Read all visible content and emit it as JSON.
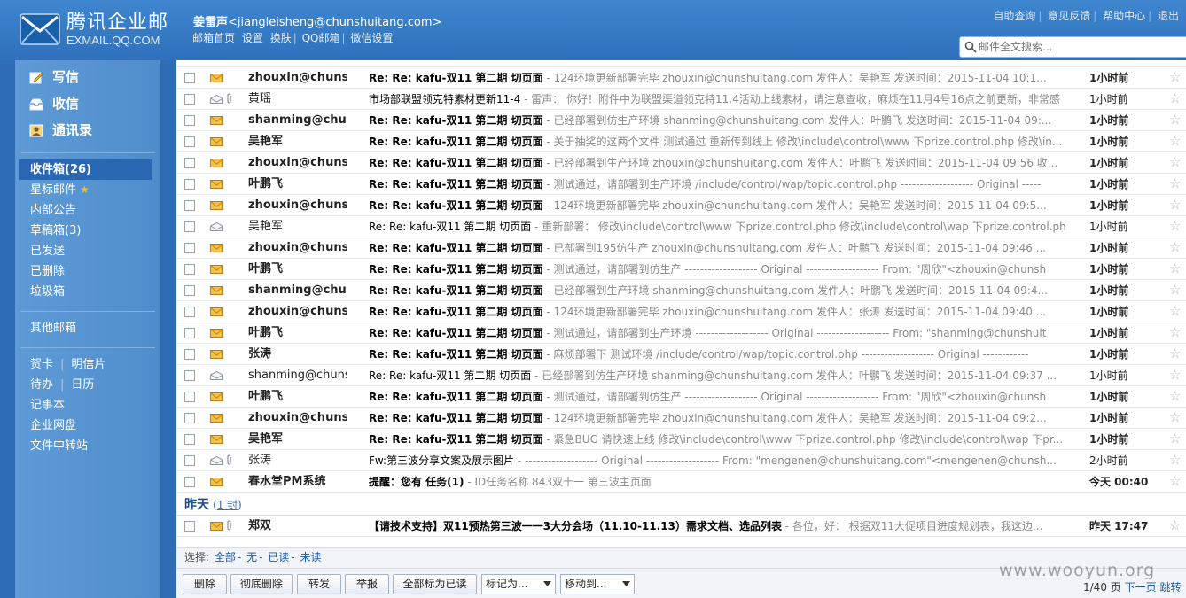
{
  "header": {
    "logo_name": "腾讯企业邮",
    "logo_domain": "EXMAIL.QQ.COM",
    "user_name": "姜雷声",
    "user_email": "<jiangleisheng@chunshuitang.com>",
    "nav": [
      "邮箱首页",
      "设置",
      "换肤",
      "QQ邮箱",
      "微信设置"
    ],
    "links": [
      "自助查询",
      "意见反馈",
      "帮助中心",
      "退出"
    ],
    "search_placeholder": "邮件全文搜索..."
  },
  "sidebar": {
    "actions": [
      {
        "label": "写信",
        "icon": "compose-icon"
      },
      {
        "label": "收信",
        "icon": "inbox-icon"
      },
      {
        "label": "通讯录",
        "icon": "contacts-icon"
      }
    ],
    "folders": [
      "收件箱(26)",
      "星标邮件",
      "内部公告",
      "草稿箱(3)",
      "已发送",
      "已删除",
      "垃圾箱"
    ],
    "other": "其他邮箱",
    "tools": [
      [
        "贺卡",
        "明信片"
      ],
      [
        "待办",
        "日历"
      ],
      [
        "记事本"
      ],
      [
        "企业网盘"
      ],
      [
        "文件中转站"
      ]
    ]
  },
  "mail_list": {
    "rows": [
      {
        "read": false,
        "clip": false,
        "sender": "zhouxin@chunshuitang.com",
        "subject": "Re: Re: kafu-双11 第二期  切页面",
        "preview": "  -  124环境更新部署完毕 zhouxin@chunshuitang.com 发件人：吴艳军 发送时间：2015-11-04 10:1...",
        "time": "1小时前"
      },
      {
        "read": true,
        "clip": true,
        "sender": "黄瑶",
        "subject": "市场部联盟领克特素材更新11-4",
        "preview": "  -  雷声：  你好！附件中为联盟渠道领克特11.4活动上线素材，请注意查收，麻烦在11月4号16点之前更新，非常感",
        "time": "1小时前"
      },
      {
        "read": false,
        "clip": false,
        "sender": "shanming@chunshuitang.com",
        "subject": "Re: Re: kafu-双11 第二期  切页面",
        "preview": "  -  已经部署到仿生产环境 shanming@chunshuitang.com 发件人：叶鹏飞 发送时间：2015-11-04 09:...",
        "time": "1小时前"
      },
      {
        "read": false,
        "clip": false,
        "sender": "吴艳军",
        "subject": "Re: Re: kafu-双11 第二期  切页面",
        "preview": "  -  关于抽奖的这两个文件 测试通过 重新传到线上 修改\\include\\control\\www 下prize.control.php 修改\\in...",
        "time": "1小时前"
      },
      {
        "read": false,
        "clip": false,
        "sender": "zhouxin@chunshuitang.com",
        "subject": "Re: Re: kafu-双11 第二期  切页面",
        "preview": "  -  已经部署到生产环境 zhouxin@chunshuitang.com 发件人：叶鹏飞 发送时间：2015-11-04 09:56 收...",
        "time": "1小时前"
      },
      {
        "read": false,
        "clip": false,
        "sender": "叶鹏飞",
        "subject": "Re: Re: kafu-双11 第二期  切页面",
        "preview": "  -  测试通过，请部署到生产环境 /include/control/wap/topic.control.php ------------------- Original -----",
        "time": "1小时前"
      },
      {
        "read": false,
        "clip": false,
        "sender": "zhouxin@chunshuitang.com",
        "subject": "Re: Re: kafu-双11 第二期  切页面",
        "preview": "  -  124环境更新部署完毕 zhouxin@chunshuitang.com 发件人：吴艳军 发送时间：2015-11-04 09:5...",
        "time": "1小时前"
      },
      {
        "read": true,
        "clip": false,
        "sender": "吴艳军",
        "subject": "Re: Re: kafu-双11 第二期  切页面",
        "preview": "  -  重新部署：  修改\\include\\control\\www 下prize.control.php 修改\\include\\control\\wap 下prize.control.ph",
        "time": "1小时前"
      },
      {
        "read": false,
        "clip": false,
        "sender": "zhouxin@chunshuitang.com",
        "subject": "Re: Re: kafu-双11 第二期  切页面",
        "preview": "  -  已部署到195仿生产 zhouxin@chunshuitang.com 发件人：叶鹏飞 发送时间：2015-11-04 09:46 ...",
        "time": "1小时前"
      },
      {
        "read": false,
        "clip": false,
        "sender": "叶鹏飞",
        "subject": "Re: Re: kafu-双11 第二期  切页面",
        "preview": "  -  测试通过，请部署到仿生产 ------------------- Original ------------------- From: \"周欣\"<zhouxin@chunsh",
        "time": "1小时前"
      },
      {
        "read": false,
        "clip": false,
        "sender": "shanming@chunshuitang.com",
        "subject": "Re: Re: kafu-双11 第二期  切页面",
        "preview": "  -  已经部署到生产环境 shanming@chunshuitang.com 发件人：叶鹏飞 发送时间：2015-11-04 09:4...",
        "time": "1小时前"
      },
      {
        "read": false,
        "clip": false,
        "sender": "zhouxin@chunshuitang.com",
        "subject": "Re: Re: kafu-双11 第二期  切页面",
        "preview": "  -  124环境更新部署完毕 zhouxin@chunshuitang.com 发件人：张涛 发送时间：2015-11-04 09:40 ...",
        "time": "1小时前"
      },
      {
        "read": false,
        "clip": false,
        "sender": "叶鹏飞",
        "subject": "Re: Re: kafu-双11 第二期  切页面",
        "preview": "  -  测试通过，请部署到生产环境 ------------------- Original ------------------- From: \"shanming@chunshuit",
        "time": "1小时前"
      },
      {
        "read": false,
        "clip": false,
        "sender": "张涛",
        "subject": "Re: Re: kafu-双11 第二期  切页面",
        "preview": "  -  麻烦部署下 测试环境 /include/control/wap/topic.control.php ------------------- Original ------------",
        "time": "1小时前"
      },
      {
        "read": true,
        "clip": false,
        "sender": "shanming@chunshuitang.com",
        "subject": "Re: Re: kafu-双11 第二期  切页面",
        "preview": "  -  已经部署到仿生产环境 shanming@chunshuitang.com 发件人：叶鹏飞 发送时间：2015-11-04 09:37 ...",
        "time": "1小时前"
      },
      {
        "read": false,
        "clip": false,
        "sender": "叶鹏飞",
        "subject": "Re: Re: kafu-双11 第二期  切页面",
        "preview": "  -  测试通过，请部署到仿生产 ------------------- Original ------------------- From: \"周欣\"<zhouxin@chunsh",
        "time": "1小时前"
      },
      {
        "read": false,
        "clip": false,
        "sender": "zhouxin@chunshuitang.com",
        "subject": "Re: Re: kafu-双11 第二期  切页面",
        "preview": "  -  124环境更新部署完毕 zhouxin@chunshuitang.com 发件人：吴艳军 发送时间：2015-11-04 09:2...",
        "time": "1小时前"
      },
      {
        "read": false,
        "clip": false,
        "sender": "吴艳军",
        "subject": "Re: Re: kafu-双11 第二期  切页面",
        "preview": "  -  紧急BUG 请快速上线 修改\\include\\control\\www 下prize.control.php 修改\\include\\control\\wap 下pr...",
        "time": "1小时前"
      },
      {
        "read": true,
        "clip": true,
        "sender": "张涛",
        "subject": "Fw:第三波分享文案及展示图片",
        "preview": "  -  ------------------- Original ------------------- From: \"mengenen@chunshuitang.com\"<mengenen@chunsh...",
        "time": "2小时前"
      },
      {
        "read": false,
        "clip": false,
        "sender": "春水堂PM系统",
        "subject": "提醒：您有 任务(1)",
        "preview": "  -  ID任务名称 843双十一 第三波主页面",
        "time": "今天 00:40"
      }
    ],
    "group_yesterday": {
      "title": "昨天",
      "count_prefix": "(",
      "count_link": "1 封",
      "count_suffix": ")"
    },
    "yesterday_rows": [
      {
        "read": false,
        "clip": true,
        "sender": "郑双",
        "subject": "【请技术支持】双11预热第三波一一3大分会场（11.10-11.13）需求文档、选品列表",
        "preview": "  -  各位，好： 根据双11大促项目进度规划表，我这边...",
        "time": "昨天 17:47"
      }
    ]
  },
  "select_bar": {
    "label": "选择:",
    "options": [
      "全部",
      "无",
      "已读",
      "未读"
    ],
    "sep": "-"
  },
  "toolbar": {
    "buttons": [
      "删除",
      "彻底删除",
      "转发",
      "举报",
      "全部标为已读"
    ],
    "mark_as": "标记为...",
    "move_to": "移动到...",
    "page_info": "1/40 页",
    "next_page": "下一页",
    "jump": "跳转"
  },
  "watermark": "www.wooyun.org",
  "colors": {
    "header": "#3278c3",
    "sidebar": "#5592d0",
    "active_folder": "#2a67b3",
    "envelope": "#f0b429"
  }
}
